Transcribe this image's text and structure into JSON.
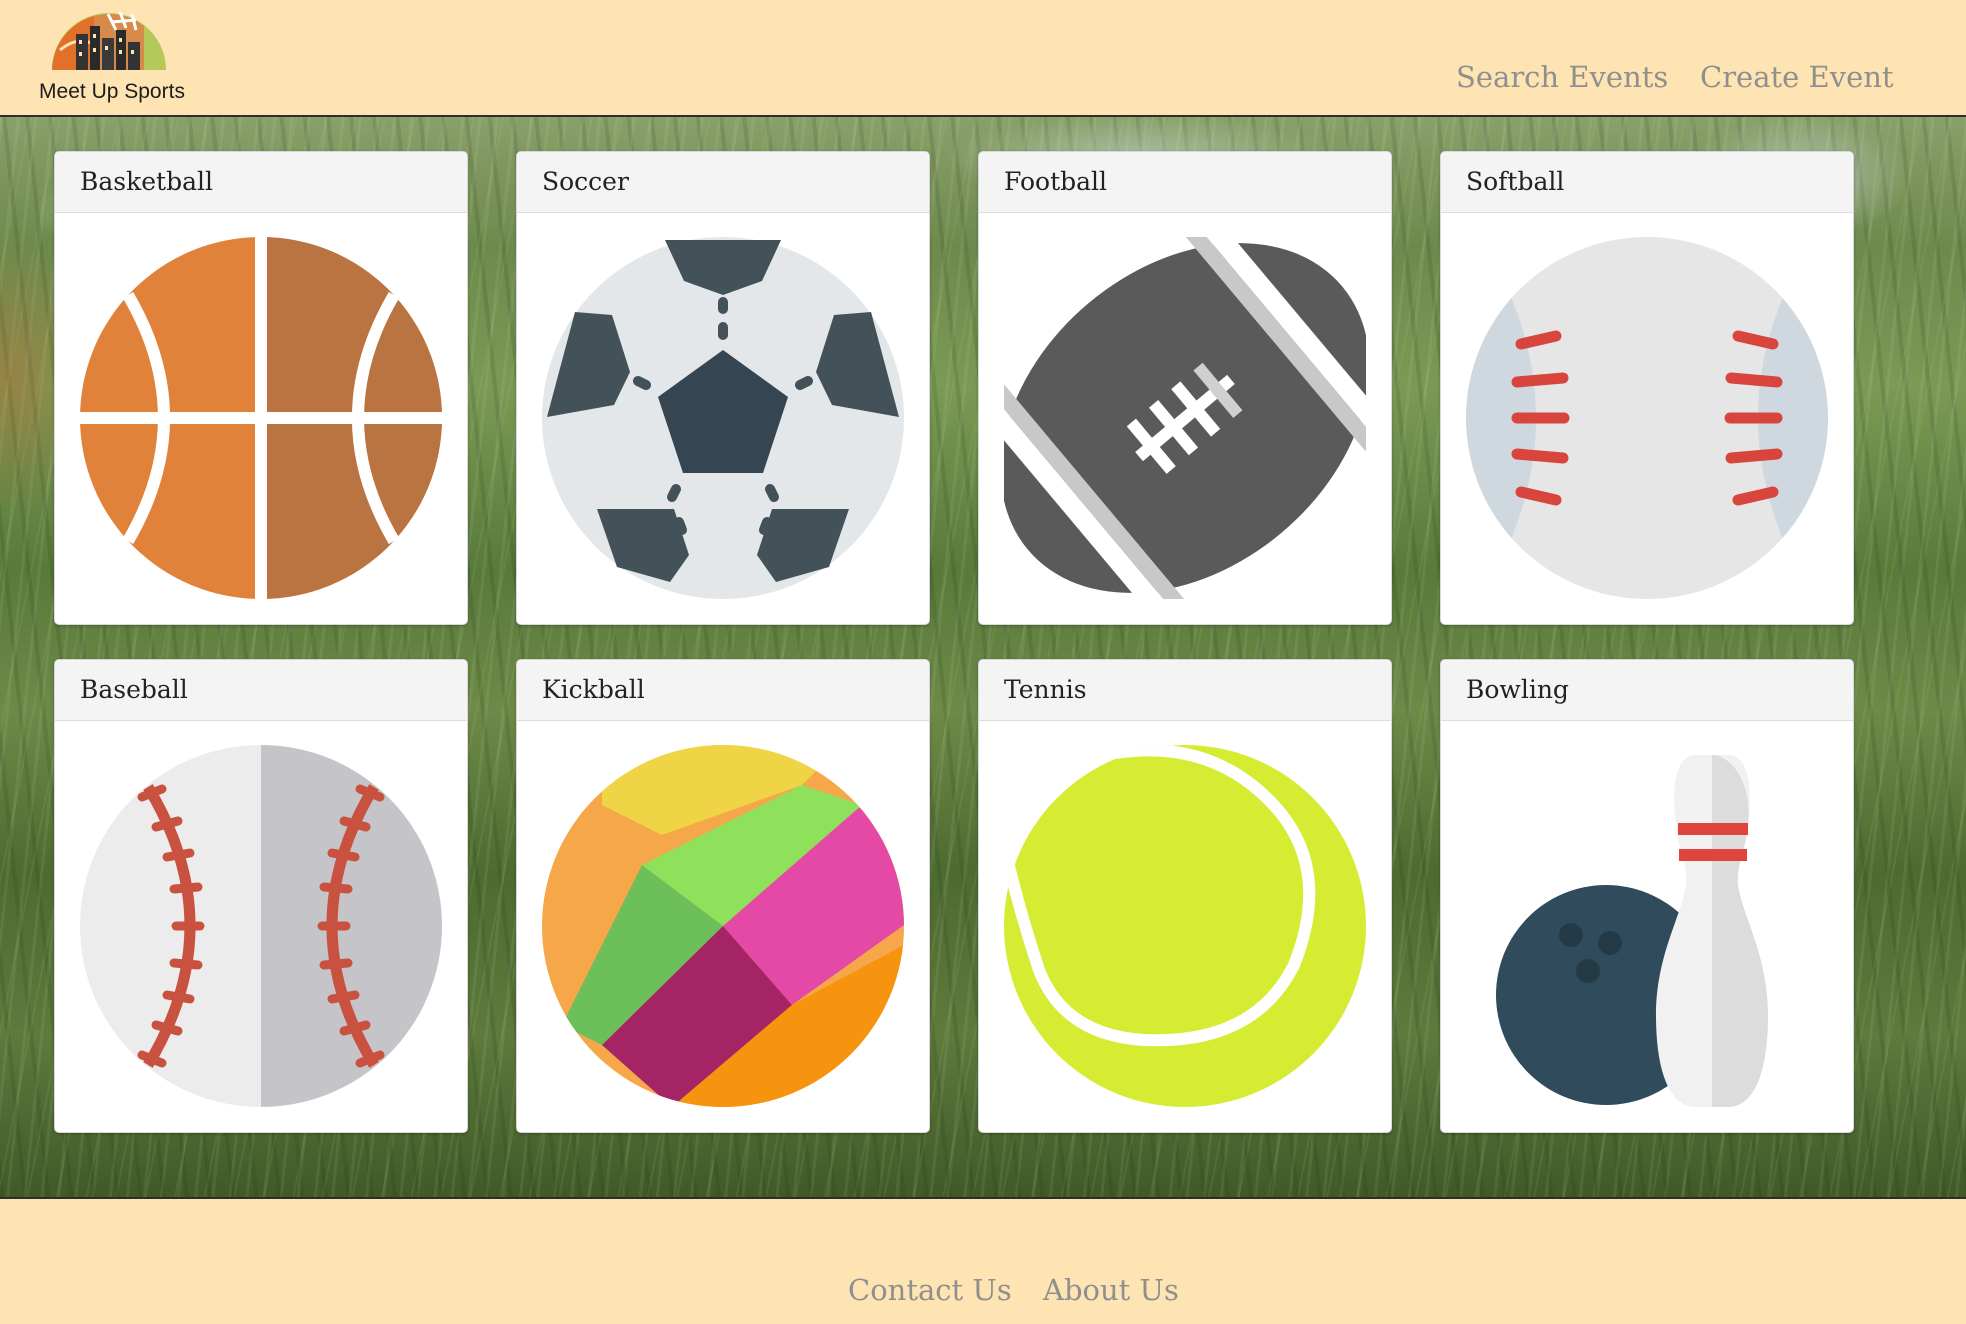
{
  "header": {
    "logo_text": "Meet Up Sports",
    "nav": [
      {
        "label": "Search Events"
      },
      {
        "label": "Create Event"
      }
    ]
  },
  "sports": [
    {
      "title": "Basketball",
      "icon": "basketball-icon"
    },
    {
      "title": "Soccer",
      "icon": "soccer-ball-icon"
    },
    {
      "title": "Football",
      "icon": "football-icon"
    },
    {
      "title": "Softball",
      "icon": "softball-icon"
    },
    {
      "title": "Baseball",
      "icon": "baseball-icon"
    },
    {
      "title": "Kickball",
      "icon": "kickball-icon"
    },
    {
      "title": "Tennis",
      "icon": "tennis-ball-icon"
    },
    {
      "title": "Bowling",
      "icon": "bowling-icon"
    }
  ],
  "footer": {
    "links": [
      {
        "label": "Contact Us"
      },
      {
        "label": "About Us"
      }
    ]
  },
  "colors": {
    "page_bg": "#fde4b2",
    "nav_text": "#8f8f8f",
    "card_header_bg": "#f4f4f4"
  }
}
